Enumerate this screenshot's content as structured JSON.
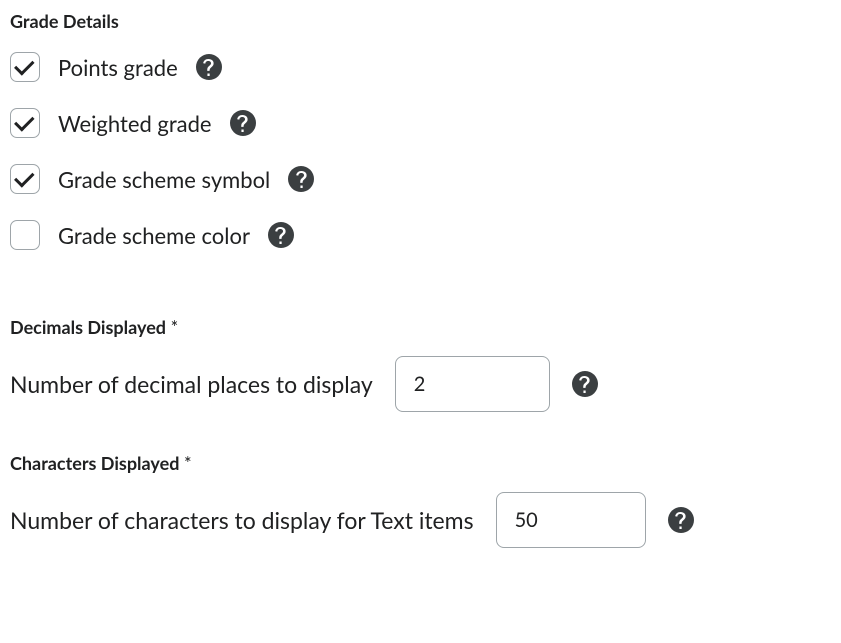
{
  "headings": {
    "grade_details": "Grade Details",
    "decimals_displayed": "Decimals Displayed",
    "characters_displayed": "Characters Displayed"
  },
  "checkboxes": {
    "points_grade": {
      "label": "Points grade",
      "checked": true
    },
    "weighted_grade": {
      "label": "Weighted grade",
      "checked": true
    },
    "grade_scheme_symbol": {
      "label": "Grade scheme symbol",
      "checked": true
    },
    "grade_scheme_color": {
      "label": "Grade scheme color",
      "checked": false
    }
  },
  "fields": {
    "decimal_places": {
      "label": "Number of decimal places to display",
      "value": "2"
    },
    "characters": {
      "label": "Number of characters to display for Text items",
      "value": "50"
    }
  },
  "required_marker": " *"
}
